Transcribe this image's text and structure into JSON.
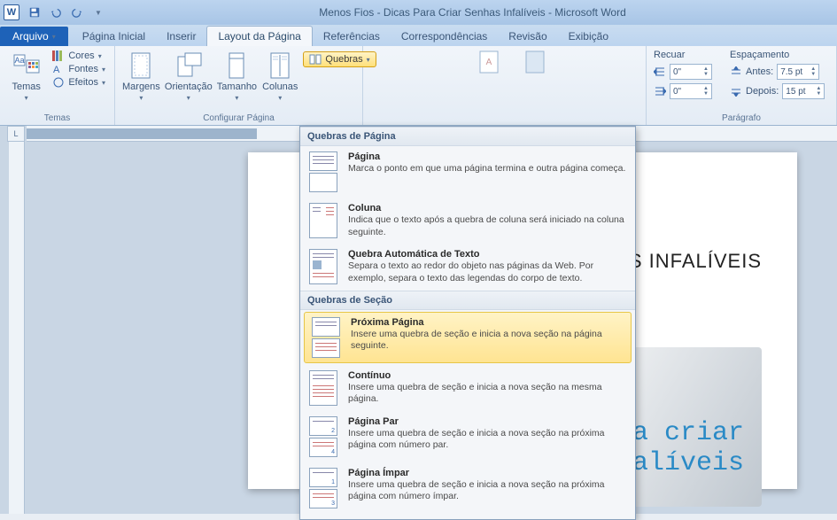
{
  "title": "Menos Fios - Dicas Para Criar Senhas Infalíveis - Microsoft Word",
  "tabs": {
    "file": "Arquivo",
    "home": "Página Inicial",
    "insert": "Inserir",
    "layout": "Layout da Página",
    "references": "Referências",
    "mail": "Correspondências",
    "review": "Revisão",
    "view": "Exibição"
  },
  "groups": {
    "themes": {
      "label": "Temas",
      "themes_btn": "Temas",
      "colors": "Cores",
      "fonts": "Fontes",
      "effects": "Efeitos"
    },
    "page_setup": {
      "label": "Configurar Página",
      "margins": "Margens",
      "orientation": "Orientação",
      "size": "Tamanho",
      "columns": "Colunas",
      "breaks": "Quebras"
    },
    "indent": {
      "label": "Recuar",
      "left_val": "0\"",
      "right_val": "0\""
    },
    "spacing": {
      "label": "Espaçamento",
      "before": "Antes:",
      "before_val": "7.5 pt",
      "after": "Depois:",
      "after_val": "15 pt"
    },
    "paragraph": "Parágrafo"
  },
  "menu": {
    "section1": "Quebras de Página",
    "page": {
      "t": "Página",
      "d": "Marca o ponto em que uma página termina e outra página começa."
    },
    "column": {
      "t": "Coluna",
      "d": "Indica que o texto após a quebra de coluna será iniciado na coluna seguinte."
    },
    "textwrap": {
      "t": "Quebra Automática de Texto",
      "d": "Separa o texto ao redor do objeto nas páginas da Web. Por exemplo, separa o texto das legendas do corpo de texto."
    },
    "section2": "Quebras de Seção",
    "nextpage": {
      "t": "Próxima Página",
      "d": "Insere uma quebra de seção e inicia a nova seção na página seguinte."
    },
    "continuous": {
      "t": "Contínuo",
      "d": "Insere uma quebra de seção e inicia a nova seção na mesma página."
    },
    "evenpage": {
      "t": "Página Par",
      "d": "Insere uma quebra de seção e inicia a nova seção na próxima página com número par."
    },
    "oddpage": {
      "t": "Página Ímpar",
      "d": "Insere uma quebra de seção e inicia a nova seção na próxima página com número ímpar."
    }
  },
  "doc": {
    "headline": "HAS INFALÍVEIS",
    "img_line1": "s para criar",
    "img_line2": "senhas infalíveis"
  },
  "ruler_corner": "L"
}
